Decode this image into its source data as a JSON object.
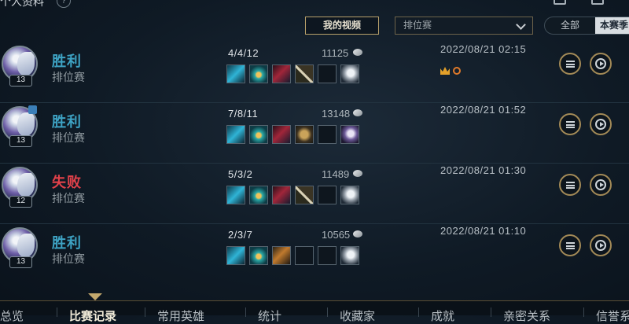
{
  "header": {
    "title": "个人资料",
    "help_icon": "question-icon"
  },
  "toolbar": {
    "video_button": "我的视频",
    "queue_select": {
      "value": "排位赛"
    },
    "scope_tabs": [
      {
        "label": "全部",
        "active": false
      },
      {
        "label": "本赛季",
        "active": true
      }
    ]
  },
  "matches": [
    {
      "result": "胜利",
      "outcome": "win",
      "mode": "排位赛",
      "level": "13",
      "kda": "4/4/12",
      "gold": "11125",
      "datetime": "2022/08/21 02:15",
      "has_honor": true,
      "has_badge": false,
      "items": [
        "cyan-item-icon",
        "teal-item-icon",
        "crimson-item-icon",
        "spear-item-icon",
        "empty-slot",
        "ward-icon"
      ]
    },
    {
      "result": "胜利",
      "outcome": "win",
      "mode": "排位赛",
      "level": "13",
      "kda": "7/8/11",
      "gold": "13148",
      "datetime": "2022/08/21 01:52",
      "has_honor": false,
      "has_badge": true,
      "items": [
        "cyan-item-icon",
        "teal-item-icon",
        "crimson-item-icon",
        "golden-item-icon",
        "empty-slot",
        "purple-ward-icon"
      ]
    },
    {
      "result": "失败",
      "outcome": "loss",
      "mode": "排位赛",
      "level": "12",
      "kda": "5/3/2",
      "gold": "11489",
      "datetime": "2022/08/21 01:30",
      "has_honor": false,
      "has_badge": false,
      "items": [
        "cyan-item-icon",
        "teal-item-icon",
        "crimson-item-icon",
        "spear-item-icon",
        "empty-slot",
        "ward-icon"
      ]
    },
    {
      "result": "胜利",
      "outcome": "win",
      "mode": "排位赛",
      "level": "13",
      "kda": "2/3/7",
      "gold": "10565",
      "datetime": "2022/08/21 01:10",
      "has_honor": false,
      "has_badge": false,
      "items": [
        "cyan-item-icon",
        "teal-item-icon",
        "orange-item-icon",
        "empty-slot",
        "empty-slot",
        "ward-icon"
      ]
    }
  ],
  "bottom_nav": [
    {
      "label": "总览",
      "active": false
    },
    {
      "label": "比赛记录",
      "active": true
    },
    {
      "label": "常用英雄",
      "active": false
    },
    {
      "label": "统计",
      "active": false
    },
    {
      "label": "收藏家",
      "active": false
    },
    {
      "label": "成就",
      "active": false
    },
    {
      "label": "亲密关系",
      "active": false
    },
    {
      "label": "信誉系",
      "active": false
    }
  ],
  "colors": {
    "win": "#3ea3c4",
    "loss": "#e0414a",
    "gold_border": "#a38a57",
    "background": "#0f1a25"
  }
}
